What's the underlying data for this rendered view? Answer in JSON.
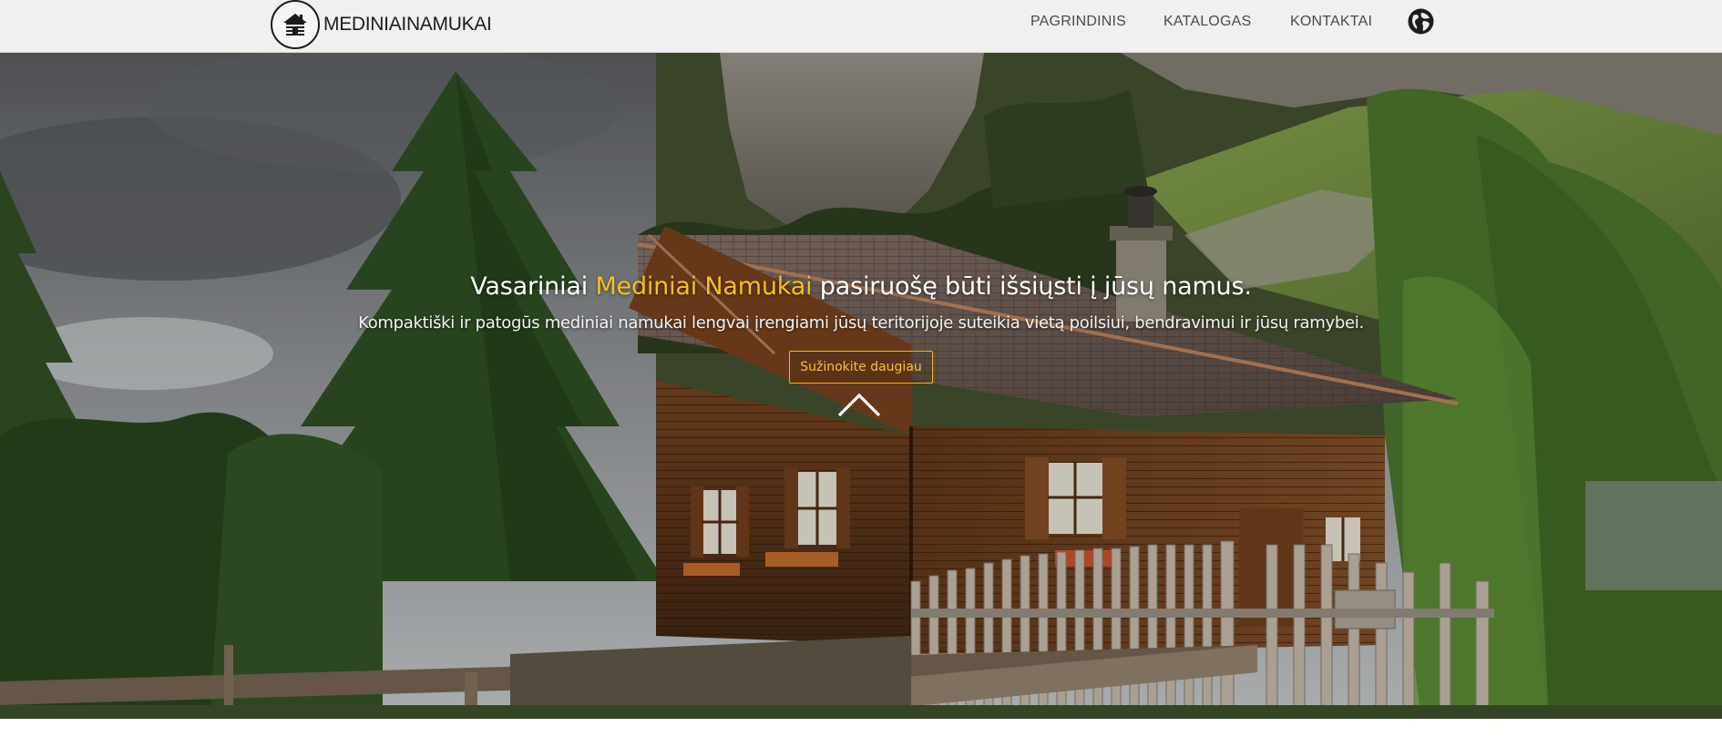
{
  "brand": {
    "name": "MEDINIAINAMUKAI",
    "logo_icon": "cabin-logo-icon"
  },
  "nav": {
    "items": [
      {
        "label": "PAGRINDINIS"
      },
      {
        "label": "KATALOGAS"
      },
      {
        "label": "KONTAKTAI"
      }
    ],
    "language_icon": "globe-icon"
  },
  "hero": {
    "headline_before": "Vasariniai ",
    "headline_accent": "Mediniai Namukai",
    "headline_after": " pasiruošę būti išsiųsti į jūsų namus.",
    "subline": "Kompaktiški ir patogūs mediniai namukai lengvai įrengiami jūsų teritorijoje suteikia vietą poilsiui, bendravimui ir jūsų ramybei.",
    "cta_label": "Sužinokite daugiau",
    "scroll_icon": "chevron-up-icon",
    "background": "mountain-log-cabin-photo"
  },
  "colors": {
    "accent": "#f6c01b",
    "header_bg": "#f1f0ee",
    "nav_text": "#4a4a4a"
  }
}
